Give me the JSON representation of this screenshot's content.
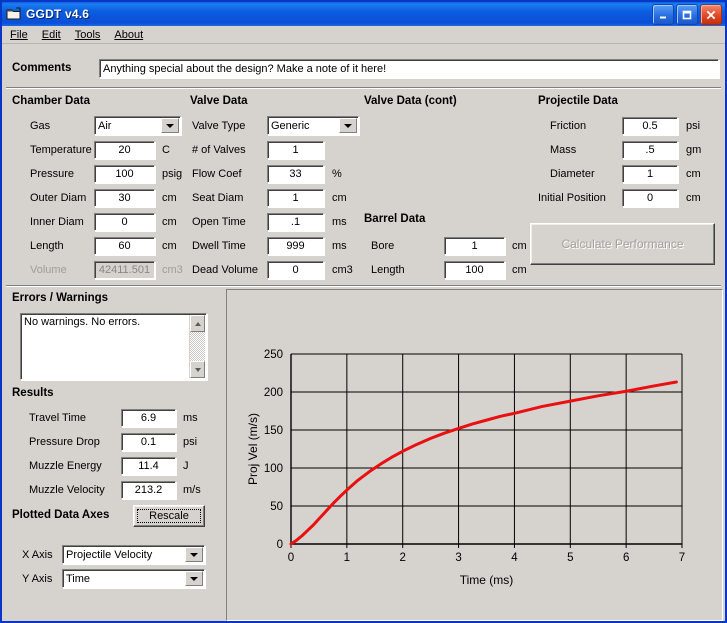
{
  "window": {
    "title": "GGDT v4.6",
    "icon": "app-icon",
    "buttons": {
      "minimize": "minimize",
      "maximize": "maximize",
      "close": "close"
    }
  },
  "menu": [
    {
      "label": "File",
      "accel": "F"
    },
    {
      "label": "Edit",
      "accel": "E"
    },
    {
      "label": "Tools",
      "accel": "T"
    },
    {
      "label": "About",
      "accel": "A"
    }
  ],
  "comments": {
    "label": "Comments",
    "value": "Anything special about the design?  Make a note of it here!"
  },
  "chamber": {
    "heading": "Chamber Data",
    "rows": [
      {
        "label": "Gas",
        "value": "Air",
        "unit": "",
        "type": "combo",
        "disabled": false
      },
      {
        "label": "Temperature",
        "value": "20",
        "unit": "C",
        "type": "text",
        "disabled": false
      },
      {
        "label": "Pressure",
        "value": "100",
        "unit": "psig",
        "type": "text",
        "disabled": false
      },
      {
        "label": "Outer Diam",
        "value": "30",
        "unit": "cm",
        "type": "text",
        "disabled": false
      },
      {
        "label": "Inner Diam",
        "value": "0",
        "unit": "cm",
        "type": "text",
        "disabled": false
      },
      {
        "label": "Length",
        "value": "60",
        "unit": "cm",
        "type": "text",
        "disabled": false
      },
      {
        "label": "Volume",
        "value": "42411.501",
        "unit": "cm3",
        "type": "text",
        "disabled": true
      }
    ]
  },
  "valve": {
    "heading": "Valve Data",
    "rows": [
      {
        "label": "Valve Type",
        "value": "Generic",
        "unit": "",
        "type": "combo",
        "disabled": false
      },
      {
        "label": "# of Valves",
        "value": "1",
        "unit": "",
        "type": "text",
        "disabled": false
      },
      {
        "label": "Flow Coef",
        "value": "33",
        "unit": "%",
        "type": "text",
        "disabled": false
      },
      {
        "label": "Seat Diam",
        "value": "1",
        "unit": "cm",
        "type": "text",
        "disabled": false
      },
      {
        "label": "Open Time",
        "value": ".1",
        "unit": "ms",
        "type": "text",
        "disabled": false
      },
      {
        "label": "Dwell Time",
        "value": "999",
        "unit": "ms",
        "type": "text",
        "disabled": false
      },
      {
        "label": "Dead Volume",
        "value": "0",
        "unit": "cm3",
        "type": "text",
        "disabled": false
      }
    ]
  },
  "valve_cont": {
    "heading": "Valve Data (cont)",
    "barrel": {
      "heading": "Barrel Data",
      "rows": [
        {
          "label": "Bore",
          "value": "1",
          "unit": "cm"
        },
        {
          "label": "Length",
          "value": "100",
          "unit": "cm"
        }
      ]
    }
  },
  "projectile": {
    "heading": "Projectile Data",
    "rows": [
      {
        "label": "Friction",
        "value": "0.5",
        "unit": "psi"
      },
      {
        "label": "Mass",
        "value": ".5",
        "unit": "gm"
      },
      {
        "label": "Diameter",
        "value": "1",
        "unit": "cm"
      },
      {
        "label": "Initial Position",
        "value": "0",
        "unit": "cm"
      }
    ],
    "calculate_button": {
      "label": "Calculate Performance",
      "disabled": true
    }
  },
  "errors": {
    "heading": "Errors / Warnings",
    "text": "No warnings.  No errors."
  },
  "results": {
    "heading": "Results",
    "rows": [
      {
        "label": "Travel Time",
        "value": "6.9",
        "unit": "ms"
      },
      {
        "label": "Pressure Drop",
        "value": "0.1",
        "unit": "psi"
      },
      {
        "label": "Muzzle Energy",
        "value": "11.4",
        "unit": "J"
      },
      {
        "label": "Muzzle Velocity",
        "value": "213.2",
        "unit": "m/s"
      }
    ]
  },
  "plotted_axes": {
    "heading": "Plotted Data Axes",
    "rescale_label": "Rescale",
    "x_axis": {
      "label": "X Axis",
      "value": "Projectile Velocity"
    },
    "y_axis": {
      "label": "Y Axis",
      "value": "Time"
    }
  },
  "colors": {
    "curve": "#e81010",
    "window_border": "#0a36c8",
    "face": "#d6d3ce",
    "plot_bg": "#d6d3ce"
  },
  "chart_data": {
    "type": "line",
    "title": "",
    "xlabel": "Time (ms)",
    "ylabel": "Proj Vel (m/s)",
    "xlim": [
      0,
      7
    ],
    "ylim": [
      0,
      250
    ],
    "xticks": [
      0,
      1,
      2,
      3,
      4,
      5,
      6,
      7
    ],
    "yticks": [
      0,
      50,
      100,
      150,
      200,
      250
    ],
    "grid": true,
    "legend": "none",
    "series": [
      {
        "name": "Projectile Velocity",
        "color": "#e81010",
        "x": [
          0.0,
          0.1,
          0.2,
          0.3,
          0.4,
          0.5,
          0.6,
          0.75,
          0.9,
          1.0,
          1.2,
          1.4,
          1.6,
          1.8,
          2.0,
          2.25,
          2.5,
          2.75,
          3.0,
          3.25,
          3.5,
          3.75,
          4.0,
          4.5,
          5.0,
          5.5,
          6.0,
          6.5,
          6.9
        ],
        "y": [
          0,
          5,
          11,
          18,
          25,
          33,
          41,
          53,
          64,
          71,
          84,
          95,
          105,
          114,
          122,
          131,
          139,
          146,
          152,
          158,
          163,
          168,
          172,
          181,
          188,
          195,
          201,
          208,
          213.2
        ]
      }
    ]
  }
}
